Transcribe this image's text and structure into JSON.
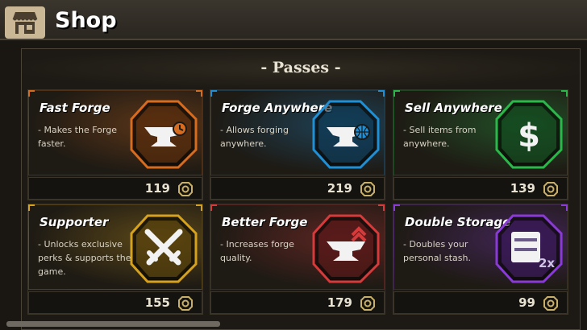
{
  "header": {
    "title": "Shop",
    "icon": "shop-icon"
  },
  "section": {
    "title": "- Passes -"
  },
  "cards": [
    {
      "name": "Fast Forge",
      "desc": "- Makes the Forge faster.",
      "price": "119",
      "icon": "anvil-clock-icon",
      "accent": "#d76b1e"
    },
    {
      "name": "Forge Anywhere",
      "desc": "- Allows forging anywhere.",
      "price": "219",
      "icon": "anvil-globe-icon",
      "accent": "#1f8fd6"
    },
    {
      "name": "Sell Anywhere",
      "desc": "- Sell items from anywhere.",
      "price": "139",
      "icon": "dollar-icon",
      "accent": "#2bb84a"
    },
    {
      "name": "Supporter",
      "desc": "- Unlocks exclusive perks & supports the game.",
      "price": "155",
      "icon": "crossed-swords-icon",
      "accent": "#d6a21e"
    },
    {
      "name": "Better Forge",
      "desc": "- Increases forge quality.",
      "price": "179",
      "icon": "anvil-arrows-icon",
      "accent": "#d63a3a"
    },
    {
      "name": "Double Storage",
      "desc": "- Doubles your personal stash.",
      "price": "99",
      "icon": "storage-2x-icon",
      "accent": "#8a3ad6"
    }
  ],
  "currency_icon": "coin-icon"
}
